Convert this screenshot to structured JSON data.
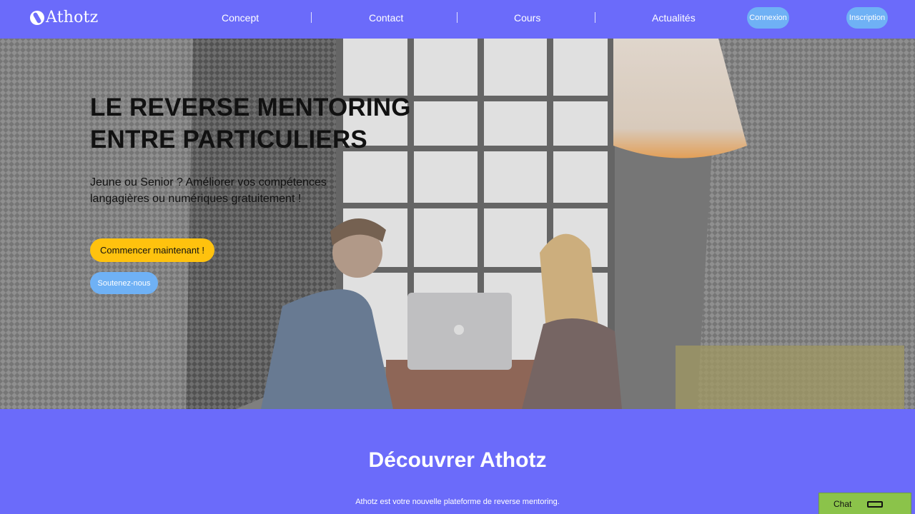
{
  "header": {
    "brand": "Athotz",
    "nav": [
      "Concept",
      "Contact",
      "Cours",
      "Actualités"
    ],
    "login_label": "Connexion",
    "signup_label": "Inscription"
  },
  "hero": {
    "title_line1": "LE REVERSE MENTORING",
    "title_line2": "ENTRE PARTICULIERS",
    "subtitle_line1": "Jeune ou Senior ? Améliorer vos compétences",
    "subtitle_line2": "langagières ou numériques gratuitement !",
    "primary_cta": "Commencer maintenant !",
    "secondary_cta": "Soutenez-nous"
  },
  "section": {
    "title": "Découvrer Athotz",
    "text": "Athotz est votre nouvelle plateforme de reverse mentoring."
  },
  "chat": {
    "label": "Chat"
  },
  "colors": {
    "brand": "#6b6bfa",
    "accent_yellow": "#ffc20e",
    "accent_blue": "#6fb1f5",
    "chat_green": "#8bc34a"
  }
}
